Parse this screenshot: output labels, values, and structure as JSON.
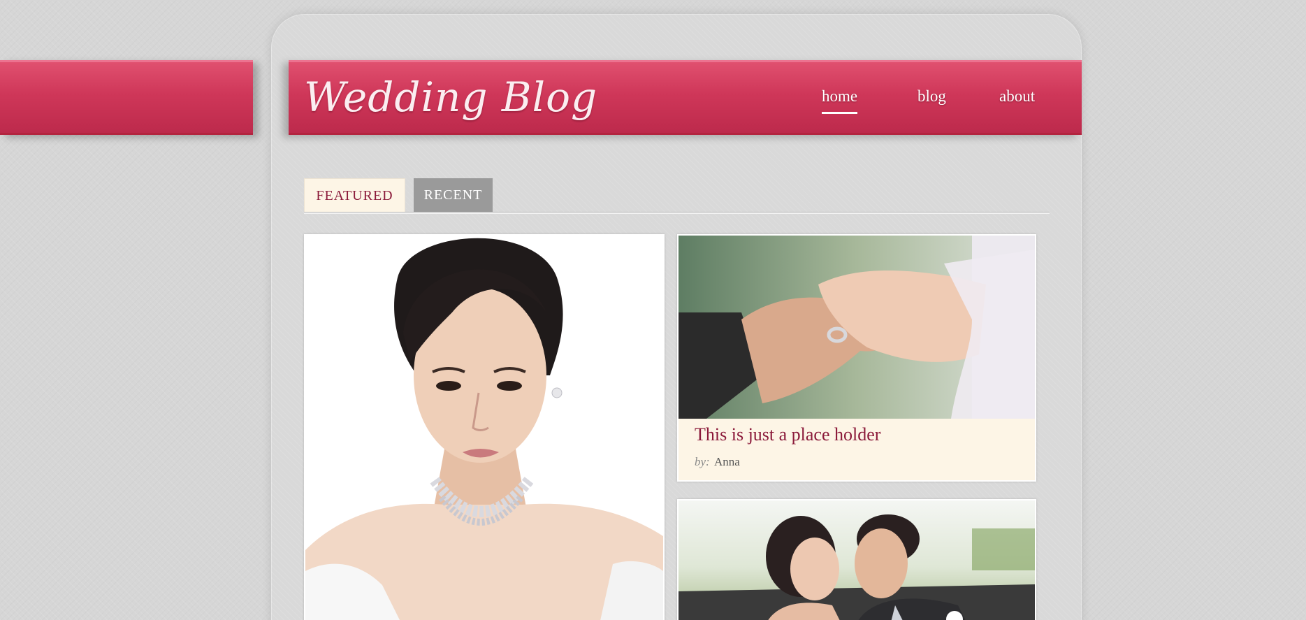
{
  "site": {
    "logo_text": "Wedding Blog",
    "brand_color": "#cf3759",
    "accent_text_color": "#8b1a3a"
  },
  "nav": {
    "items": [
      {
        "label": "home",
        "active": true
      },
      {
        "label": "blog",
        "active": false
      },
      {
        "label": "about",
        "active": false
      }
    ]
  },
  "tabs": [
    {
      "label": "FEATURED",
      "active": true
    },
    {
      "label": "RECENT",
      "active": false
    }
  ],
  "posts": {
    "featured": {
      "image": "bride-portrait"
    },
    "card1": {
      "image": "ring-exchange-hands",
      "title": "This is just a place holder",
      "by_label": "by:",
      "author": "Anna"
    },
    "card2": {
      "image": "couple-kissing-in-car"
    }
  }
}
